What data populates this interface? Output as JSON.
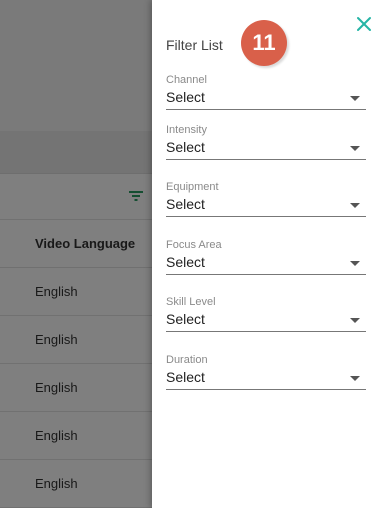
{
  "background": {
    "table_header": {
      "video_language": "Video Language"
    },
    "rows": [
      {
        "video_language": "English"
      },
      {
        "video_language": "English"
      },
      {
        "video_language": "English"
      },
      {
        "video_language": "English"
      },
      {
        "video_language": "English"
      }
    ]
  },
  "drawer": {
    "title": "Filter List",
    "step_badge": "11",
    "fields": [
      {
        "label": "Channel",
        "value": "Select"
      },
      {
        "label": "Intensity",
        "value": "Select"
      },
      {
        "label": "Equipment",
        "value": "Select"
      },
      {
        "label": "Focus Area",
        "value": "Select"
      },
      {
        "label": "Skill Level",
        "value": "Select"
      },
      {
        "label": "Duration",
        "value": "Select"
      }
    ]
  },
  "colors": {
    "accent_teal": "#26b5a6",
    "badge": "#d9604a",
    "filter_icon": "#2a9d63"
  },
  "icons": {
    "close": "close-icon",
    "filter": "filter-icon",
    "dropdown": "chevron-down-icon"
  }
}
